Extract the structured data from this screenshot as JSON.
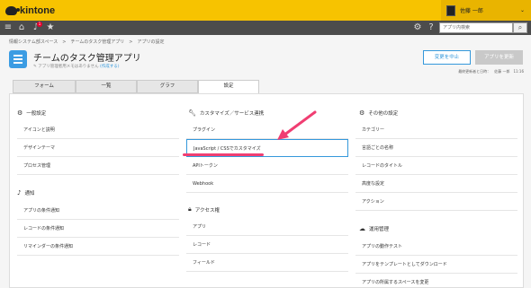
{
  "header": {
    "logo_text": "kintone",
    "user_name": "佐藤 一郎",
    "user_caret": "⌄"
  },
  "navbar": {
    "search_placeholder": "アプリ内検索",
    "notification_count": "1"
  },
  "breadcrumb": "情報システム部スペース　>　チームのタスク管理アプリ　>　アプリの設定",
  "app": {
    "title": "チームのタスク管理アプリ",
    "meta": "アプリ管理者用メモはありません",
    "meta_link": "(作成する)"
  },
  "actions": {
    "cancel_label": "変更を中止",
    "update_label": "アプリを更新",
    "last_updated": "最終更新者と日時：　佐藤 一郎　11:16"
  },
  "tabs": [
    {
      "label": "フォーム"
    },
    {
      "label": "一覧"
    },
    {
      "label": "グラフ"
    },
    {
      "label": "設定"
    }
  ],
  "columns": {
    "general": {
      "heading": "一般設定",
      "icon": "gear-icon",
      "items": [
        "アイコンと説明",
        "デザインテーマ",
        "プロセス管理"
      ]
    },
    "notifications": {
      "heading": "通知",
      "icon": "bell-icon",
      "items": [
        "アプリの条件通知",
        "レコードの条件通知",
        "リマインダーの条件通知"
      ]
    },
    "customize": {
      "heading": "カスタマイズ／サービス連携",
      "icon": "wrench-icon",
      "items": [
        "プラグイン",
        "JavaScript / CSSでカスタマイズ",
        "APIトークン",
        "Webhook"
      ]
    },
    "access": {
      "heading": "アクセス権",
      "icon": "lock-icon",
      "items": [
        "アプリ",
        "レコード",
        "フィールド"
      ]
    },
    "other": {
      "heading": "その他の設定",
      "icon": "gears-icon",
      "items": [
        "カテゴリー",
        "言語ごとの名称",
        "レコードのタイトル",
        "高度な設定",
        "アクション"
      ]
    },
    "operations": {
      "heading": "運用管理",
      "icon": "cloud-icon",
      "items": [
        "アプリの動作テスト",
        "アプリをテンプレートとしてダウンロード",
        "アプリの所属するスペースを変更"
      ]
    }
  },
  "colors": {
    "header_yellow": "#f7c300",
    "nav_dark": "#4c4c4c",
    "accent_blue": "#3498db",
    "annotation_pink": "#f03e72"
  }
}
